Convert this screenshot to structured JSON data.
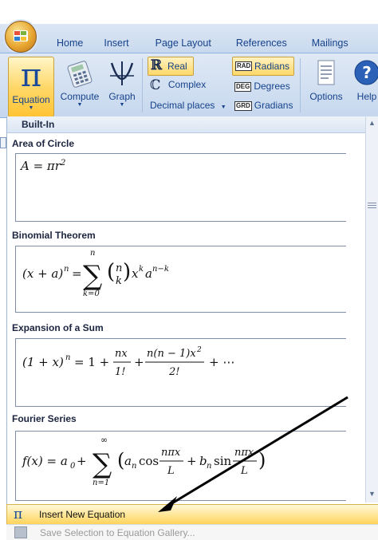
{
  "tabs": [
    "Home",
    "Insert",
    "Page Layout",
    "References",
    "Mailings"
  ],
  "ribbon": {
    "equation": "Equation",
    "compute": "Compute",
    "graph": "Graph",
    "real": "Real",
    "complex": "Complex",
    "decimal_places": "Decimal places",
    "radians": "Radians",
    "degrees": "Degrees",
    "gradians": "Gradians",
    "rad_tag": "RAD",
    "deg_tag": "DEG",
    "grd_tag": "GRD",
    "options": "Options",
    "help": "Help"
  },
  "gallery": {
    "header": "Built-In",
    "sections": [
      {
        "title": "Area of Circle"
      },
      {
        "title": "Binomial Theorem"
      },
      {
        "title": "Expansion of a Sum"
      },
      {
        "title": "Fourier Series"
      }
    ]
  },
  "menu": {
    "insert_new": "Insert New Equation",
    "save_selection": "Save Selection to Equation Gallery..."
  },
  "colors": {
    "accent": "#ffd86a",
    "ribbon": "#c6d7ee",
    "text": "#15428b"
  }
}
